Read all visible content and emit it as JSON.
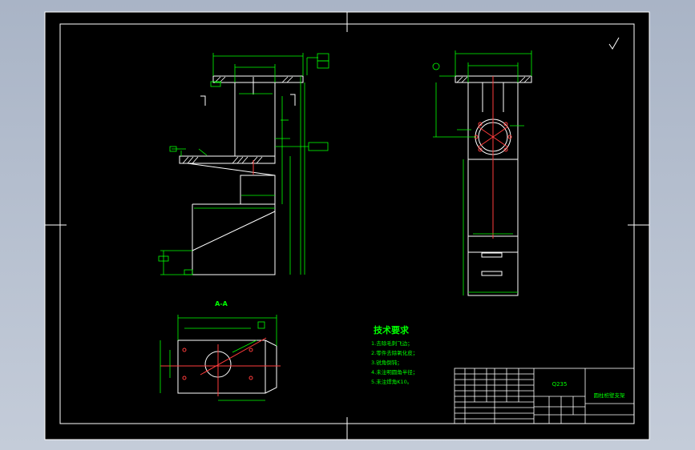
{
  "drawing": {
    "tech_title": "技术要求",
    "tech_notes": [
      "1.去除毛刺飞边；",
      "2.零件去除氧化皮；",
      "3.锐角倒钝；",
      "4.未注明圆角半径；",
      "5.未注焊角K10。"
    ],
    "section_label": "A-A",
    "material": "Q235",
    "part_name": "圆柱桩壁支架",
    "colors": {
      "background": "#000000",
      "line": "#ffffff",
      "dimension": "#00ff00",
      "center": "#ff0000",
      "text_cyan": "#00ffff",
      "frame_outer": "#2b3347"
    }
  }
}
